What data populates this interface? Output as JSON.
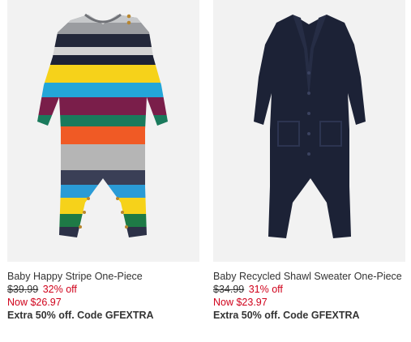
{
  "products": [
    {
      "name": "Baby Happy Stripe One-Piece",
      "original_price": "$39.99",
      "discount": "32% off",
      "now_price": "Now $26.97",
      "promo": "Extra 50% off. Code GFEXTRA",
      "image_icon": "striped-romper-image"
    },
    {
      "name": "Baby Recycled Shawl Sweater One-Piece",
      "original_price": "$34.99",
      "discount": "31% off",
      "now_price": "Now $23.97",
      "promo": "Extra 50% off. Code GFEXTRA",
      "image_icon": "navy-romper-image"
    }
  ],
  "colors": {
    "sale_red": "#d0021b",
    "text": "#333333",
    "image_bg": "#f2f2f2",
    "navy": "#1c2236"
  }
}
